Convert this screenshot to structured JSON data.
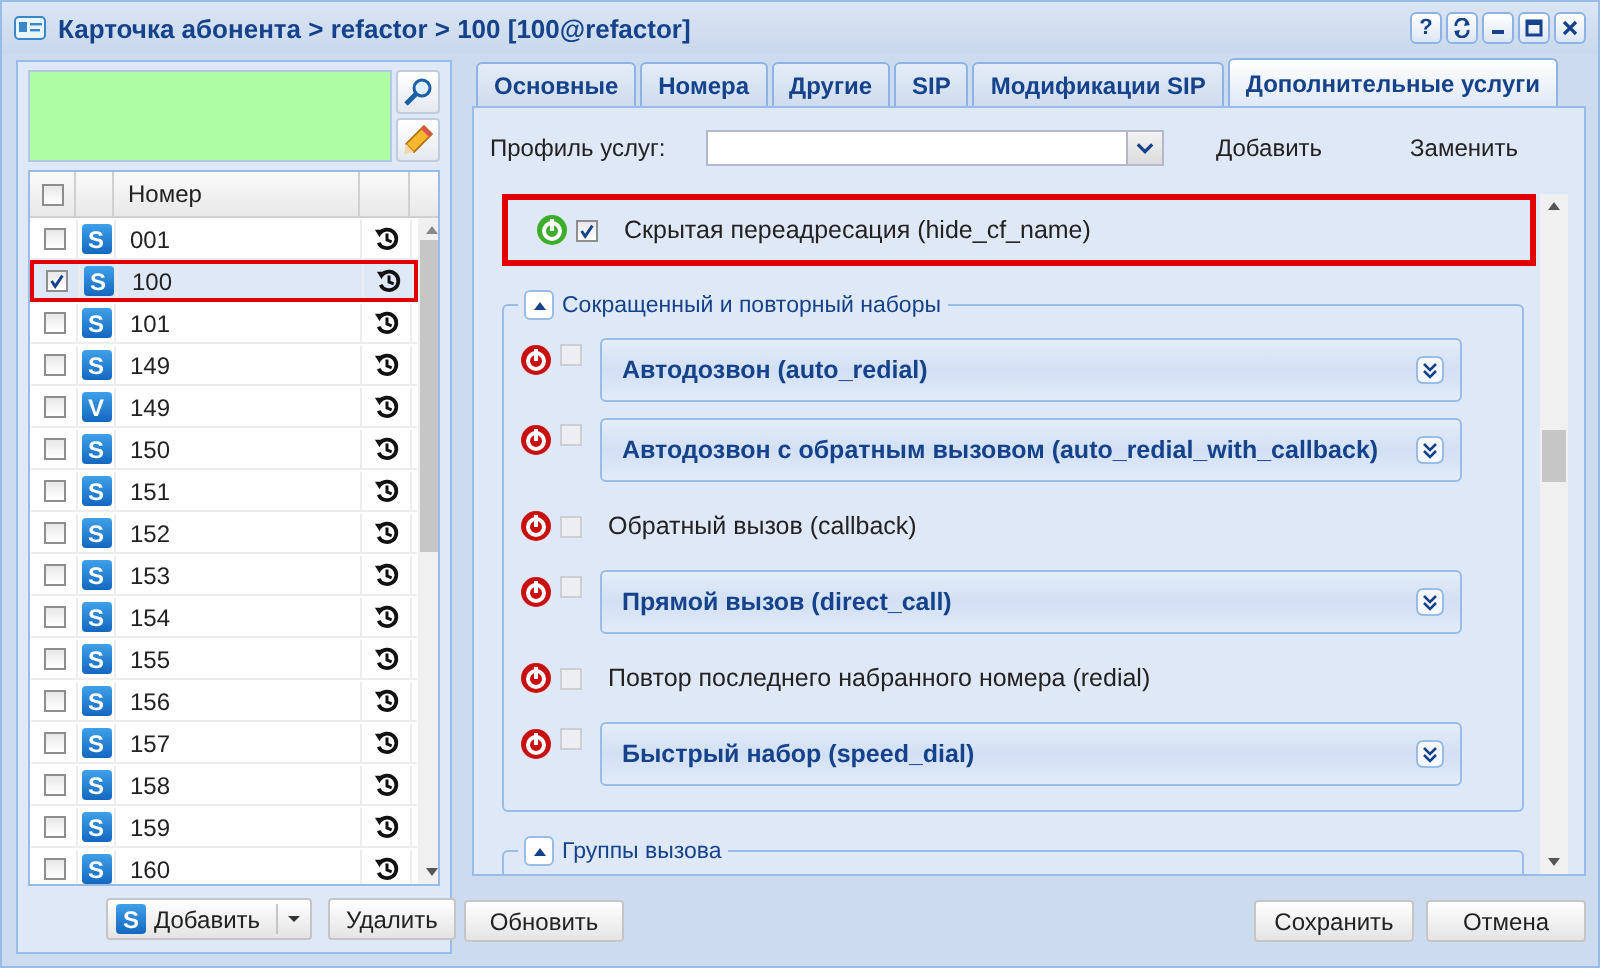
{
  "window": {
    "title": "Карточка абонента > refactor > 100 [100@refactor]",
    "help": "?"
  },
  "grid": {
    "header": "Номер",
    "all_checked": false,
    "rows": [
      {
        "badge": "S",
        "number": "001",
        "checked": false,
        "selected": false,
        "highlighted": false
      },
      {
        "badge": "S",
        "number": "100",
        "checked": true,
        "selected": true,
        "highlighted": true
      },
      {
        "badge": "S",
        "number": "101",
        "checked": false,
        "selected": false,
        "highlighted": false
      },
      {
        "badge": "S",
        "number": "149",
        "checked": false,
        "selected": false,
        "highlighted": false
      },
      {
        "badge": "V",
        "number": "149",
        "checked": false,
        "selected": false,
        "highlighted": false
      },
      {
        "badge": "S",
        "number": "150",
        "checked": false,
        "selected": false,
        "highlighted": false
      },
      {
        "badge": "S",
        "number": "151",
        "checked": false,
        "selected": false,
        "highlighted": false
      },
      {
        "badge": "S",
        "number": "152",
        "checked": false,
        "selected": false,
        "highlighted": false
      },
      {
        "badge": "S",
        "number": "153",
        "checked": false,
        "selected": false,
        "highlighted": false
      },
      {
        "badge": "S",
        "number": "154",
        "checked": false,
        "selected": false,
        "highlighted": false
      },
      {
        "badge": "S",
        "number": "155",
        "checked": false,
        "selected": false,
        "highlighted": false
      },
      {
        "badge": "S",
        "number": "156",
        "checked": false,
        "selected": false,
        "highlighted": false
      },
      {
        "badge": "S",
        "number": "157",
        "checked": false,
        "selected": false,
        "highlighted": false
      },
      {
        "badge": "S",
        "number": "158",
        "checked": false,
        "selected": false,
        "highlighted": false
      },
      {
        "badge": "S",
        "number": "159",
        "checked": false,
        "selected": false,
        "highlighted": false
      },
      {
        "badge": "S",
        "number": "160",
        "checked": false,
        "selected": false,
        "highlighted": false
      }
    ]
  },
  "left_buttons": {
    "add": {
      "badge": "S",
      "label": "Добавить"
    },
    "delete": "Удалить"
  },
  "tabs": [
    {
      "label": "Основные",
      "selected": false
    },
    {
      "label": "Номера",
      "selected": false
    },
    {
      "label": "Другие",
      "selected": false
    },
    {
      "label": "SIP",
      "selected": false
    },
    {
      "label": "Модификации SIP",
      "selected": false
    },
    {
      "label": "Дополнительные услуги",
      "selected": true
    }
  ],
  "profile": {
    "label": "Профиль услуг:",
    "add": "Добавить",
    "replace": "Заменить"
  },
  "top_service": {
    "kind": "plain",
    "label": "Скрытая переадресация (hide_cf_name)",
    "enabled": true,
    "checked": true,
    "highlighted": true
  },
  "groups": [
    {
      "title": "Сокращенный и повторный наборы",
      "expanded": true,
      "items": [
        {
          "kind": "panel",
          "label": "Автодозвон (auto_redial)",
          "enabled": false,
          "checked": false
        },
        {
          "kind": "panel",
          "label": "Автодозвон с обратным вызовом (auto_redial_with_callback)",
          "enabled": false,
          "checked": false
        },
        {
          "kind": "plain",
          "label": "Обратный вызов (callback)",
          "enabled": false,
          "checked": false
        },
        {
          "kind": "panel",
          "label": "Прямой вызов (direct_call)",
          "enabled": false,
          "checked": false
        },
        {
          "kind": "plain",
          "label": "Повтор последнего набранного номера (redial)",
          "enabled": false,
          "checked": false
        },
        {
          "kind": "panel",
          "label": "Быстрый набор (speed_dial)",
          "enabled": false,
          "checked": false
        }
      ]
    },
    {
      "title": "Группы вызова",
      "expanded": true
    }
  ],
  "footer": {
    "refresh": "Обновить",
    "save": "Сохранить",
    "cancel": "Отмена"
  }
}
